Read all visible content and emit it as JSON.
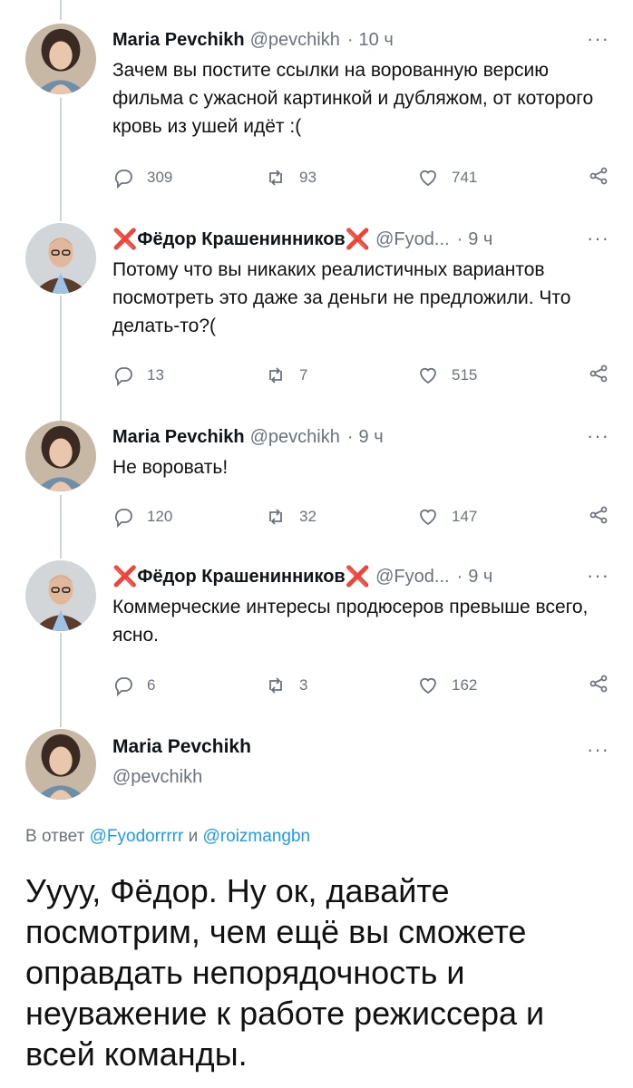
{
  "tweets": [
    {
      "name": "Maria Pevchikh",
      "handle": "@pevchikh",
      "sep": "·",
      "time": "10 ч",
      "text": "Зачем вы постите ссылки на ворованную версию фильма с ужасной картинкой и дубляжом, от которого кровь из ушей идёт :(",
      "replies": "309",
      "retweets": "93",
      "likes": "741"
    },
    {
      "cross_left": "❌",
      "name": "Фёдор Крашенинников",
      "cross_right": "❌",
      "handle": "@Fyod...",
      "sep": "·",
      "time": "9 ч",
      "text": "Потому что вы никаких реалистичных вариантов посмотреть это даже за деньги не предложили. Что делать-то?(",
      "replies": "13",
      "retweets": "7",
      "likes": "515"
    },
    {
      "name": "Maria Pevchikh",
      "handle": "@pevchikh",
      "sep": "·",
      "time": "9 ч",
      "text": "Не воровать!",
      "replies": "120",
      "retweets": "32",
      "likes": "147"
    },
    {
      "cross_left": "❌",
      "name": "Фёдор Крашенинников",
      "cross_right": "❌",
      "handle": "@Fyod...",
      "sep": "·",
      "time": "9 ч",
      "text": "Коммерческие интересы продюсеров превыше всего, ясно.",
      "replies": "6",
      "retweets": "3",
      "likes": "162"
    }
  ],
  "more_label": "···",
  "main": {
    "name": "Maria Pevchikh",
    "handle": "@pevchikh",
    "reply_prefix": "В ответ",
    "reply_user1": "@Fyodorrrrr",
    "reply_and": "и",
    "reply_user2": "@roizmangbn",
    "text": "Уууу, Фёдор. Ну ок, давайте посмотрим, чем ещё вы сможете оправдать непорядочность и неуважение к работе режиссера и всей команды."
  },
  "icons": {
    "reply": "reply-icon",
    "retweet": "retweet-icon",
    "like": "heart-icon",
    "share": "share-icon",
    "more": "more-icon"
  },
  "colors": {
    "link": "#1d9bf0",
    "muted": "#6a737d",
    "cross": "#e0243a",
    "thread_line": "#cfd4d8"
  }
}
